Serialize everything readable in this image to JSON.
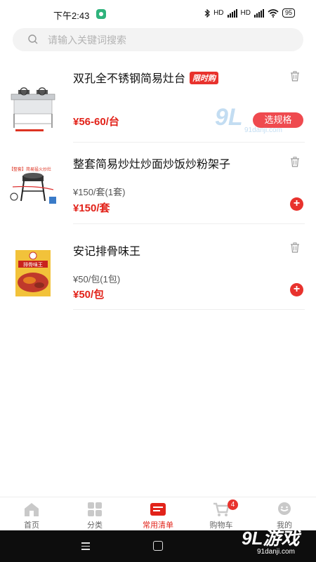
{
  "status_bar": {
    "time": "下午2:43",
    "network_1": "HD",
    "network_2": "HD",
    "battery": "95"
  },
  "search": {
    "placeholder": "请输入关键词搜索"
  },
  "products": [
    {
      "name": "双孔全不锈钢简易灶台",
      "badge": "限时购",
      "price": "¥56-60/台",
      "action_label": "选规格",
      "image_caption": ""
    },
    {
      "name": "整套简易炒灶炒面炒饭炒粉架子",
      "spec": "¥150/套(1套)",
      "price": "¥150/套",
      "image_caption": "【整套】简易猛火炒灶"
    },
    {
      "name": "安记排骨味王",
      "spec": "¥50/包(1包)",
      "price": "¥50/包",
      "image_caption": "排骨味王"
    }
  ],
  "tabs": [
    {
      "label": "首页",
      "icon": "home-icon"
    },
    {
      "label": "分类",
      "icon": "grid-icon"
    },
    {
      "label": "常用清单",
      "icon": "list-icon",
      "active": true
    },
    {
      "label": "购物车",
      "icon": "cart-icon",
      "badge": "4"
    },
    {
      "label": "我的",
      "icon": "user-icon"
    }
  ],
  "watermark": {
    "logo": "9L游戏",
    "url": "91danji.com",
    "mid_logo": "9L",
    "mid_url": "91danji.com"
  },
  "colors": {
    "accent": "#e2231a",
    "badge_bg": "#e8322d"
  }
}
